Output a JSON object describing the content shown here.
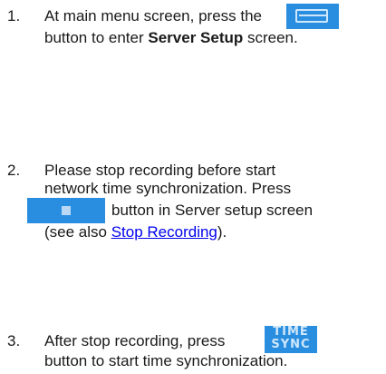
{
  "steps": [
    {
      "number": "1.",
      "line1_pre": "At main menu screen, press the",
      "line2_pre": "button to enter ",
      "line2_bold": "Server Setup",
      "line2_post": " screen.",
      "icon": "server-setup-icon"
    },
    {
      "number": "2.",
      "line1": "Please stop recording before start",
      "line2": "network time synchronization. Press",
      "line3_post": "button in Server setup screen",
      "line4_pre": "(see also ",
      "line4_link": "Stop Recording",
      "line4_post": ").",
      "icon": "stop-icon"
    },
    {
      "number": "3.",
      "line1_pre": "After stop recording, press",
      "line2": "button to start time synchronization.",
      "icon": "time-sync-icon",
      "icon_text_top": "TIME",
      "icon_text_bottom": "SYNC"
    }
  ],
  "colors": {
    "icon_bg": "#2a8ee0",
    "link": "#0000ee"
  }
}
